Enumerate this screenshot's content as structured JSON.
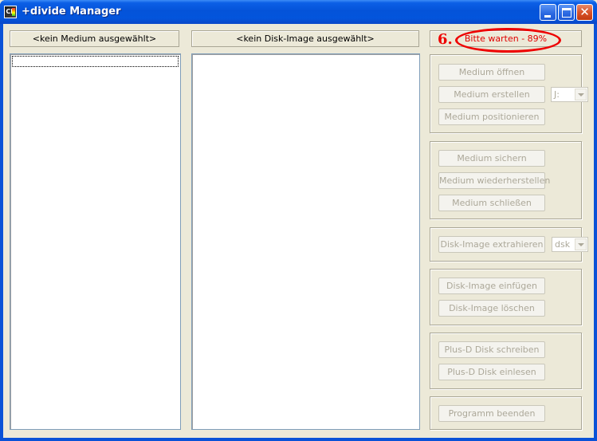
{
  "window": {
    "title": "+divide Manager",
    "icon_text": "CF"
  },
  "panes": {
    "medium_header": "<kein Medium ausgewählt>",
    "disk_header": "<kein Disk-Image ausgewählt>"
  },
  "status": {
    "text": "Bitte warten - 89%",
    "annotation_number": "6.",
    "annotation_color": "#e00000"
  },
  "buttons": {
    "medium_oeffnen": "Medium öffnen",
    "medium_erstellen": "Medium erstellen",
    "medium_positionieren": "Medium positionieren",
    "medium_sichern": "Medium sichern",
    "medium_wiederherstellen": "Medium wiederherstellen",
    "medium_schliessen": "Medium schließen",
    "disk_extrahieren": "Disk-Image extrahieren",
    "disk_einfuegen": "Disk-Image einfügen",
    "disk_loeschen": "Disk-Image löschen",
    "plusd_schreiben": "Plus-D Disk schreiben",
    "plusd_einlesen": "Plus-D Disk einlesen",
    "programm_beenden": "Programm beenden"
  },
  "combos": {
    "drive": "J:",
    "format": "dsk"
  }
}
